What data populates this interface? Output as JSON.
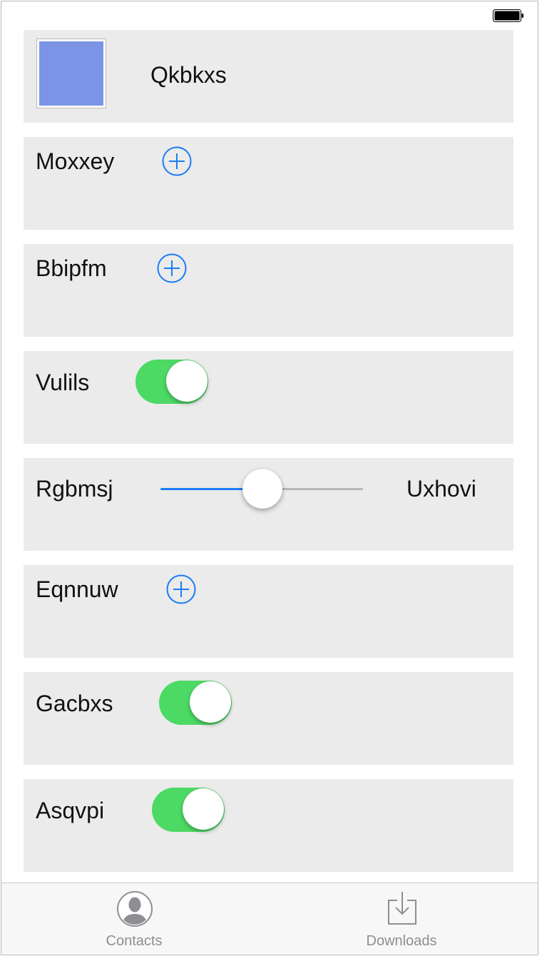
{
  "rows": [
    {
      "type": "image",
      "label": "Qkbkxs"
    },
    {
      "type": "add",
      "label": "Moxxey"
    },
    {
      "type": "add",
      "label": "Bbipfm"
    },
    {
      "type": "toggle",
      "label": "Vulils",
      "on": true
    },
    {
      "type": "slider",
      "label": "Rgbmsj",
      "value_label": "Uxhovi",
      "value": 0.5
    },
    {
      "type": "add",
      "label": "Eqnnuw"
    },
    {
      "type": "toggle",
      "label": "Gacbxs",
      "on": true
    },
    {
      "type": "toggle",
      "label": "Asqvpi",
      "on": true
    }
  ],
  "tabbar": {
    "tabs": [
      {
        "label": "Contacts",
        "icon": "contacts-icon"
      },
      {
        "label": "Downloads",
        "icon": "downloads-icon"
      }
    ]
  },
  "colors": {
    "accent": "#1a7cf5",
    "toggle_on": "#4cd964",
    "row_bg": "#ebebeb",
    "image_fill": "#7b94e6"
  }
}
